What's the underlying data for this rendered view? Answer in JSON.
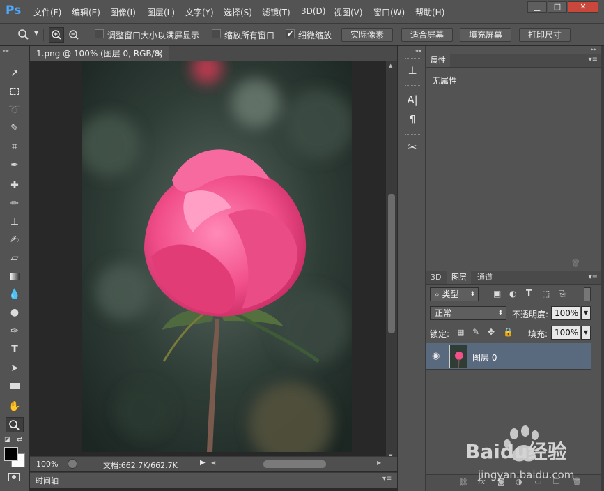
{
  "app": {
    "logo": "Ps"
  },
  "menu": {
    "items": [
      "文件(F)",
      "编辑(E)",
      "图像(I)",
      "图层(L)",
      "文字(Y)",
      "选择(S)",
      "滤镜(T)",
      "3D(D)",
      "视图(V)",
      "窗口(W)",
      "帮助(H)"
    ]
  },
  "window_controls": {
    "minimize": "▁",
    "restore": "□",
    "close": "✕"
  },
  "options": {
    "checkbox1_label": "调整窗口大小以满屏显示",
    "checkbox2_label": "缩放所有窗口",
    "checkbox3_label": "细微缩放",
    "checkbox3_checked": "✔",
    "buttons": [
      "实际像素",
      "适合屏幕",
      "填充屏幕",
      "打印尺寸"
    ]
  },
  "document": {
    "tab_title": "1.png @ 100% (图层 0, RGB/8)",
    "tab_close": "×",
    "zoom": "100%",
    "doc_info": "文档:662.7K/662.7K"
  },
  "timeline": {
    "label": "时间轴"
  },
  "properties": {
    "tab": "属性",
    "body_text": "无属性"
  },
  "layers": {
    "tabs": [
      "3D",
      "图层",
      "通道"
    ],
    "filter_kind": "类型",
    "blend_mode": "正常",
    "opacity_label": "不透明度:",
    "opacity_value": "100%",
    "lock_label": "锁定:",
    "fill_label": "填充:",
    "fill_value": "100%",
    "layer_name": "图层 0"
  },
  "watermark": {
    "brand": "Baidu经验",
    "url": "jingyan.baidu.com"
  },
  "colors": {
    "panel_bg": "#535353",
    "canvas_bg": "#282828",
    "selected_layer": "#5a6a7e",
    "ps_logo": "#4ea9ff"
  }
}
